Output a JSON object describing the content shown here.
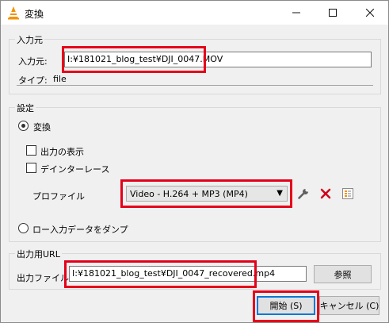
{
  "window": {
    "title": "変換"
  },
  "source": {
    "group_title": "入力元",
    "source_label": "入力元:",
    "source_value": "I:¥181021_blog_test¥DJI_0047.MOV",
    "type_label": "タイプ:",
    "type_value": "file"
  },
  "settings": {
    "group_title": "設定",
    "convert_label": "変換",
    "show_output_label": "出力の表示",
    "deinterlace_label": "デインターレース",
    "profile_label": "プロファイル",
    "profile_value": "Video - H.264 + MP3 (MP4)",
    "dump_raw_label": "ロー入力データをダンプ"
  },
  "destination": {
    "group_title": "出力用URL",
    "dest_label": "出力ファイル:",
    "dest_value": "I:¥181021_blog_test¥DJI_0047_recovered.mp4",
    "browse_label": "参照"
  },
  "footer": {
    "start_label": "開始 (S)",
    "cancel_label": "キャンセル (C)"
  },
  "colors": {
    "highlight": "#e5001a",
    "delete_red": "#d0021b",
    "focus": "#0078d7"
  },
  "icons": [
    "vlc-cone-icon",
    "minimize-icon",
    "maximize-icon",
    "close-icon",
    "wrench-icon",
    "delete-icon",
    "new-profile-icon",
    "dropdown-arrow-icon"
  ]
}
